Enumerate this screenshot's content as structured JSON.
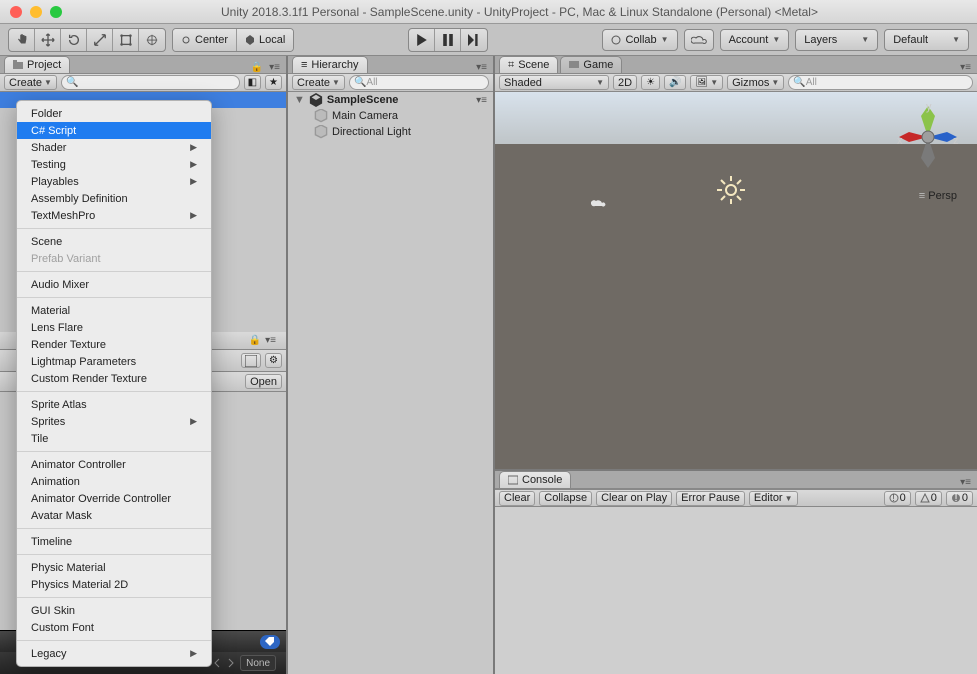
{
  "title": "Unity 2018.3.1f1 Personal - SampleScene.unity - UnityProject - PC, Mac & Linux Standalone (Personal) <Metal>",
  "toolbar": {
    "center": "Center",
    "local": "Local",
    "collab": "Collab",
    "account": "Account",
    "layers": "Layers",
    "layout": "Default"
  },
  "project": {
    "tab": "Project",
    "create": "Create",
    "search_ph": "",
    "open": "Open",
    "none": "None"
  },
  "hierarchy": {
    "tab": "Hierarchy",
    "create": "Create",
    "scene": "SampleScene",
    "items": [
      "Main Camera",
      "Directional Light"
    ],
    "search_ph": "All"
  },
  "scene_tab": "Scene",
  "game_tab": "Game",
  "scene_bar": {
    "mode": "Shaded",
    "twoD": "2D",
    "gizmos": "Gizmos",
    "search_ph": "All",
    "persp": "Persp",
    "axes": {
      "x": "x",
      "y": "y",
      "z": "z"
    }
  },
  "console": {
    "tab": "Console",
    "clear": "Clear",
    "collapse": "Collapse",
    "clear_on_play": "Clear on Play",
    "error_pause": "Error Pause",
    "editor": "Editor",
    "counts": {
      "info": "0",
      "warn": "0",
      "error": "0"
    }
  },
  "menu": [
    {
      "label": "Folder"
    },
    {
      "label": "C# Script",
      "selected": true
    },
    {
      "label": "Shader",
      "submenu": true
    },
    {
      "label": "Testing",
      "submenu": true
    },
    {
      "label": "Playables",
      "submenu": true
    },
    {
      "label": "Assembly Definition"
    },
    {
      "label": "TextMeshPro",
      "submenu": true
    },
    {
      "sep": true
    },
    {
      "label": "Scene"
    },
    {
      "label": "Prefab Variant",
      "disabled": true
    },
    {
      "sep": true
    },
    {
      "label": "Audio Mixer"
    },
    {
      "sep": true
    },
    {
      "label": "Material"
    },
    {
      "label": "Lens Flare"
    },
    {
      "label": "Render Texture"
    },
    {
      "label": "Lightmap Parameters"
    },
    {
      "label": "Custom Render Texture"
    },
    {
      "sep": true
    },
    {
      "label": "Sprite Atlas"
    },
    {
      "label": "Sprites",
      "submenu": true
    },
    {
      "label": "Tile"
    },
    {
      "sep": true
    },
    {
      "label": "Animator Controller"
    },
    {
      "label": "Animation"
    },
    {
      "label": "Animator Override Controller"
    },
    {
      "label": "Avatar Mask"
    },
    {
      "sep": true
    },
    {
      "label": "Timeline"
    },
    {
      "sep": true
    },
    {
      "label": "Physic Material"
    },
    {
      "label": "Physics Material 2D"
    },
    {
      "sep": true
    },
    {
      "label": "GUI Skin"
    },
    {
      "label": "Custom Font"
    },
    {
      "sep": true
    },
    {
      "label": "Legacy",
      "submenu": true
    }
  ]
}
